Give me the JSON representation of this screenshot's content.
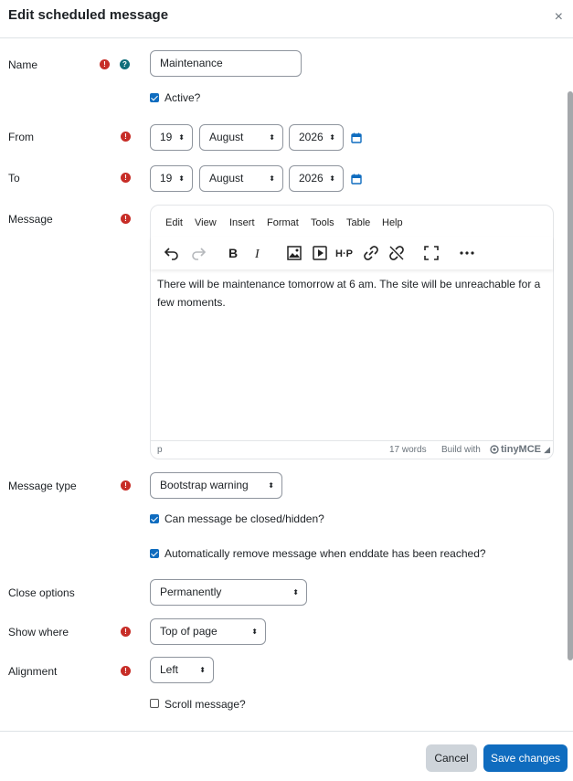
{
  "modal": {
    "title": "Edit scheduled message",
    "close_glyph": "×"
  },
  "form": {
    "name_label": "Name",
    "name_value": "Maintenance",
    "active_label": "Active?",
    "active_checked": true,
    "from_label": "From",
    "from_day": "19",
    "from_month": "August",
    "from_year": "2026",
    "to_label": "To",
    "to_day": "19",
    "to_month": "August",
    "to_year": "2026",
    "message_label": "Message",
    "message_type_label": "Message type",
    "message_type_value": "Bootstrap warning",
    "can_close_label": "Can message be closed/hidden?",
    "can_close_checked": true,
    "auto_remove_label": "Automatically remove message when enddate has been reached?",
    "auto_remove_checked": true,
    "close_options_label": "Close options",
    "close_options_value": "Permanently",
    "show_where_label": "Show where",
    "show_where_value": "Top of page",
    "alignment_label": "Alignment",
    "alignment_value": "Left",
    "scroll_label": "Scroll message?",
    "scroll_checked": false
  },
  "editor": {
    "menus": [
      "Edit",
      "View",
      "Insert",
      "Format",
      "Tools",
      "Table",
      "Help"
    ],
    "content": "There will be maintenance tomorrow at 6 am. The site will be unreachable for a few moments.",
    "status_path": "p",
    "word_count": "17 words",
    "build_with": "Build with",
    "brand": "tinyMCE",
    "toolbar_icons": [
      "undo-icon",
      "redo-icon",
      "bold-icon",
      "italic-icon",
      "image-icon",
      "media-icon",
      "h5p-icon",
      "link-icon",
      "unlink-icon",
      "fullscreen-icon",
      "more-icon"
    ]
  },
  "footer": {
    "cancel_label": "Cancel",
    "save_label": "Save changes"
  },
  "colors": {
    "primary": "#0f6cbf",
    "required": "#c72d27",
    "help": "#0f6e7a",
    "cancel_bg": "#ced4da"
  }
}
